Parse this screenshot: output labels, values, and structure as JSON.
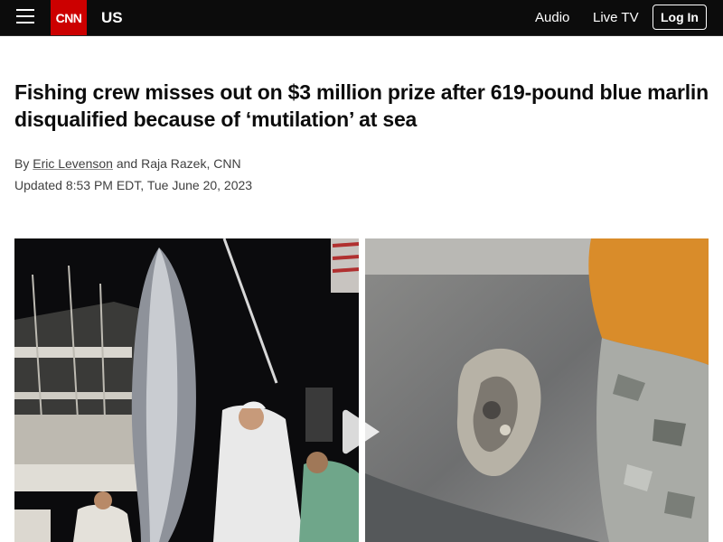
{
  "header": {
    "logo_text": "CNN",
    "section": "US",
    "nav": {
      "audio": "Audio",
      "live_tv": "Live TV"
    },
    "login_label": "Log In",
    "menu_icon": "hamburger-menu-icon",
    "colors": {
      "bar": "#0c0c0c",
      "brand": "#cc0000"
    }
  },
  "article": {
    "headline": "Fishing crew misses out on $3 million prize after 619-pound blue marlin disqualified because of ‘mutilation’ at sea",
    "byline": {
      "prefix": "By",
      "author1": "Eric Levenson",
      "joiner": "and",
      "author2": "Raja Razek",
      "suffix": ", CNN"
    },
    "updated": "Updated 8:53 PM EDT, Tue June 20, 2023"
  },
  "video": {
    "play_icon": "play-icon"
  }
}
